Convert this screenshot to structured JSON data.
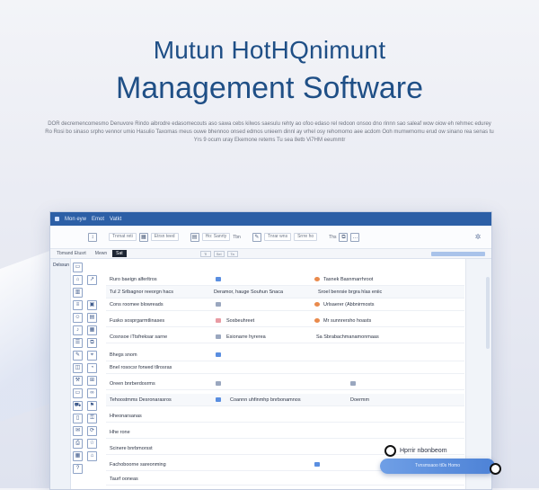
{
  "hero": {
    "line1": "Mutun HotHQnimunt",
    "line2": "Management Software",
    "description": [
      "DOR decremencomesmo Denuvore Rindo aibrodre edasomecouts aso sawa cebs kilwos saesulu rehty ao ofoo edaso rel redoon onsoo dno rinnn sao saleaf wow oiow eh rehmec edurey",
      "Ro Rosi bo sinaso srpho vennor umio Hasulio Taxomas meus ouwe bhennoo onsed edmos unieem dinnl ay vrhel osy rehomomo aee acdom Ooh mumwmomu erud ow sinano rea senas tu",
      "Yrs 9 ocum uray Ekemone retems Tu sea 8etb Vi7HM eeummtr"
    ]
  },
  "window": {
    "title_items": [
      "Mon eyw",
      "Emot",
      "Vatkt"
    ],
    "toolbar": {
      "field1": "Tnrnat reti",
      "field2": "Etrsn teed",
      "field3": "Ho: Sanrty",
      "text1": "Tbn",
      "field4": "Tnrar wns",
      "field5": "Srrre ho",
      "text2": "Ths"
    },
    "tabs": [
      "Tbmand Etusrt",
      "Mewn",
      "Sat"
    ],
    "tab_boxes": [
      "Ti",
      "Sel",
      "Ta"
    ],
    "sidebar_label": "Delssun",
    "rows": [
      {
        "c1": "Ruro baeign alferltros",
        "c3": "Tasnek Basnmarrhroot"
      },
      {
        "c1": "Tul 2 Srlbagnor reeorgn hacs",
        "c2": "Deramor, hauge Souhun Snaca",
        "c3": "Sroel benrsie brgra hlas eniic"
      },
      {
        "c1": "Cons roomee blowreads",
        "c3": "Urlsaerer (Abbnirmosts"
      },
      {
        "c1": "Fusko sosprgarmtlinases",
        "c2": "Sosbeuhreet",
        "c3": "Mr sunnrersho hoasts"
      },
      {
        "c1": "Cosnsoe iTtsfreksar sarne",
        "c2": "Esionarre hyrerea",
        "c3": "Sa Sbrabachmanamonmaas"
      },
      {
        "c1": "Bhegs snom"
      },
      {
        "c1": "Bnel rosocsr forwed tllrosras"
      },
      {
        "c1": "Oreen bnrberdosrms"
      },
      {
        "c1": "Tehoostmms Desronarasros",
        "c2": "Coannn uhfinmhp bnrbonamnos",
        "c3": "Doermm"
      },
      {
        "c1": "Hheonarsanas"
      },
      {
        "c1": "Hhe rone"
      },
      {
        "c1": "Scinere bnrbmorsst"
      },
      {
        "c1": "Fachoboorne sareonming"
      },
      {
        "c1": "Taurf ooneas"
      }
    ]
  },
  "floating": {
    "label": "Hprrir nbonbeom",
    "button": "Tvnsmsaoo tt0s Homo"
  },
  "colors": {
    "brand_blue": "#2c5fa6",
    "headline": "#1f4f86",
    "accent_button": "#4d82d6"
  }
}
